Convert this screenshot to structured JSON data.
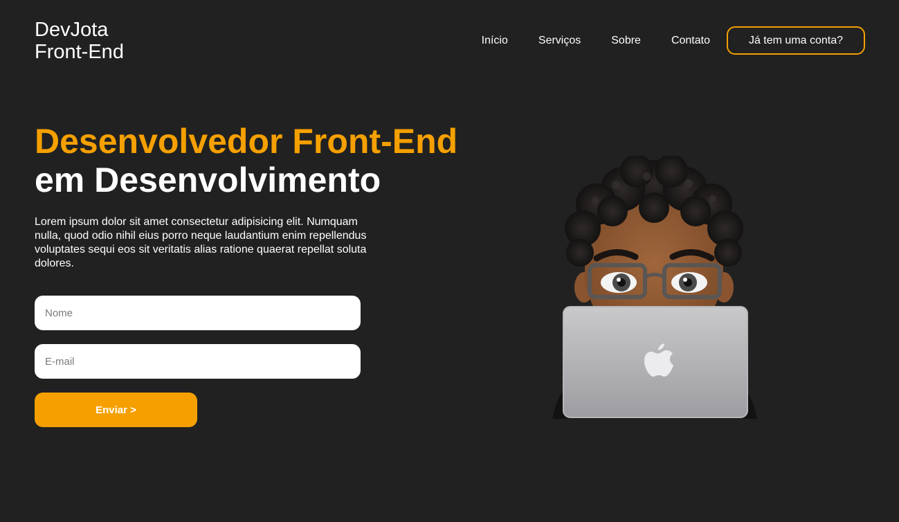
{
  "header": {
    "logo_line1": "DevJota",
    "logo_line2": "Front-End",
    "nav": [
      {
        "label": "Início"
      },
      {
        "label": "Serviços"
      },
      {
        "label": "Sobre"
      },
      {
        "label": "Contato"
      }
    ],
    "account_label": "Já tem uma conta?"
  },
  "hero": {
    "title_accent": "Desenvolvedor Front-End",
    "title_plain": "em Desenvolvimento",
    "text": "Lorem ipsum dolor sit amet consectetur adipisicing elit. Numquam nulla, quod odio nihil eius porro neque laudantium enim repellendus voluptates sequi eos sit veritatis alias ratione quaerat repellat soluta dolores."
  },
  "form": {
    "name_placeholder": "Nome",
    "email_placeholder": "E-mail",
    "submit_label": "Enviar >"
  },
  "colors": {
    "background": "#212121",
    "accent": "#f5a000",
    "text": "#ffffff"
  },
  "icons": {
    "avatar": "memoji-with-laptop-illustration",
    "laptop_logo": "apple-logo-icon"
  }
}
